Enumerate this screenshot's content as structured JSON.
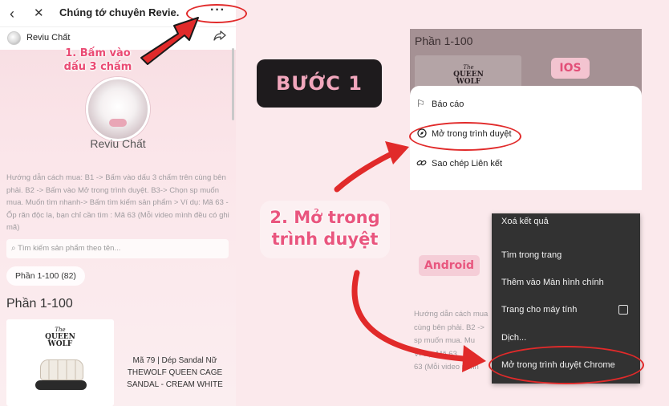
{
  "left_phone": {
    "nav": {
      "back_icon": "‹",
      "close_icon": "✕",
      "title": "Chúng tớ chuyên Revie...",
      "more_icon": "···"
    },
    "shop_bar": {
      "name": "Reviu Chất",
      "share_icon": "share-icon"
    },
    "step1_text_line1": "1.  Bấm vào",
    "step1_text_line2": "dấu 3 chấm",
    "profile_name": "Reviu Chất",
    "instructions": "Hướng dẫn cách mua: B1 -> Bấm vào dấu 3 chấm trên cùng bên phải. B2 -> Bấm vào Mở trong trình duyệt. B3-> Chọn sp muốn mua. Muốn tìm nhanh-> Bấm tìm kiếm sản phẩm > Ví dụ: Mã 63 - Ốp răn độc la, bạn chỉ cần tìm : Mã 63 (Mỗi video mình đều có ghi mã)",
    "search_placeholder": "Tìm kiếm sản phẩm theo tên...",
    "category_chip": "Phần 1-100 (82)",
    "section_heading": "Phần 1-100",
    "brand_small": "The",
    "brand_line1": "QUEEN",
    "brand_line2": "WOLF",
    "product_caption_line1": "Mã 79 | Dép Sandal Nữ",
    "product_caption_line2": "THEWOLF QUEEN CAGE",
    "product_caption_line3": "SANDAL - CREAM WHITE"
  },
  "step1_badge": "BƯỚC 1",
  "step2_line1": "2. Mở trong",
  "step2_line2": "trình duyệt",
  "ios": {
    "badge": "IOS",
    "section_heading": "Phần 1-100",
    "brand_small": "The",
    "brand_line1": "QUEEN",
    "brand_line2": "WOLF",
    "menu": [
      {
        "icon": "flag-icon",
        "glyph": "⚐",
        "label": "Báo cáo"
      },
      {
        "icon": "compass-icon",
        "glyph": "⊘",
        "label": "Mở trong trình duyệt"
      },
      {
        "icon": "link-icon",
        "glyph": "∞",
        "label": "Sao chép Liên kết"
      }
    ]
  },
  "android": {
    "badge": "Android",
    "instructions_line1": "Hướng dẫn cách mua",
    "instructions_line2": "cùng bên phải. B2 ->",
    "instructions_line3": "sp muốn mua. Mu",
    "instructions_line4": "Ví dụ: Mã 63",
    "instructions_line5": "63 (Mỗi video mình",
    "menu": [
      "Xoá kết quả",
      "Tìm trong trang",
      "Thêm vào Màn hình chính",
      "Trang cho máy tính",
      "Dịch...",
      "Mở trong trình duyệt Chrome"
    ]
  },
  "colors": {
    "highlight_red": "#e12a2a",
    "accent_pink": "#ea4a73",
    "badge_dark": "#1e1b1d"
  }
}
